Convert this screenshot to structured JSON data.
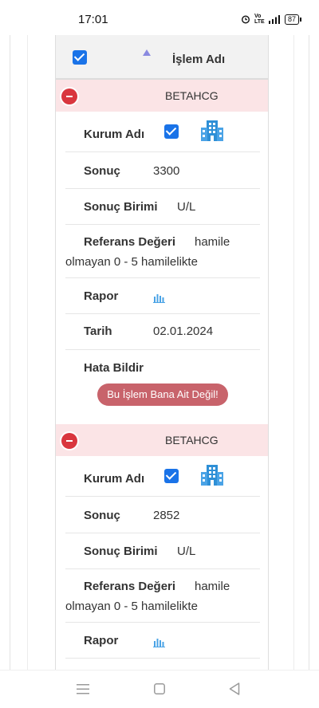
{
  "status_bar": {
    "time": "17:01",
    "battery": "87",
    "signal_text": "Vo LTE",
    "icons": [
      "alarm-icon",
      "volte-icon",
      "signal-icon",
      "battery-icon"
    ]
  },
  "table": {
    "header": {
      "select_all_checked": true,
      "sort_icon": "sort-asc-icon",
      "column_title": "İşlem Adı"
    },
    "records": [
      {
        "name": "BETAHCG",
        "kurum_label": "Kurum Adı",
        "sonuc_label": "Sonuç",
        "sonuc_value": "3300",
        "birim_label": "Sonuç Birimi",
        "birim_value": "U/L",
        "referans_label": "Referans Değeri",
        "referans_value_1": "hamile",
        "referans_value_2": "olmayan 0 - 5 hamilelikte",
        "rapor_label": "Rapor",
        "tarih_label": "Tarih",
        "tarih_value": "02.01.2024",
        "hata_label": "Hata Bildir",
        "hata_button": "Bu İşlem Bana Ait Değil!"
      },
      {
        "name": "BETAHCG",
        "kurum_label": "Kurum Adı",
        "sonuc_label": "Sonuç",
        "sonuc_value": "2852",
        "birim_label": "Sonuç Birimi",
        "birim_value": "U/L",
        "referans_label": "Referans Değeri",
        "referans_value_1": "hamile",
        "referans_value_2": "olmayan 0 - 5 hamilelikte",
        "rapor_label": "Rapor"
      }
    ]
  },
  "colors": {
    "accent": "#1a73e8",
    "record_header_bg": "#fbe4e6",
    "collapse_button": "#d9363e",
    "danger_button": "#c8636b",
    "building_icon": "#2e8fd6"
  },
  "nav_bar": {
    "icons": [
      "menu-icon",
      "home-icon",
      "back-icon"
    ]
  }
}
